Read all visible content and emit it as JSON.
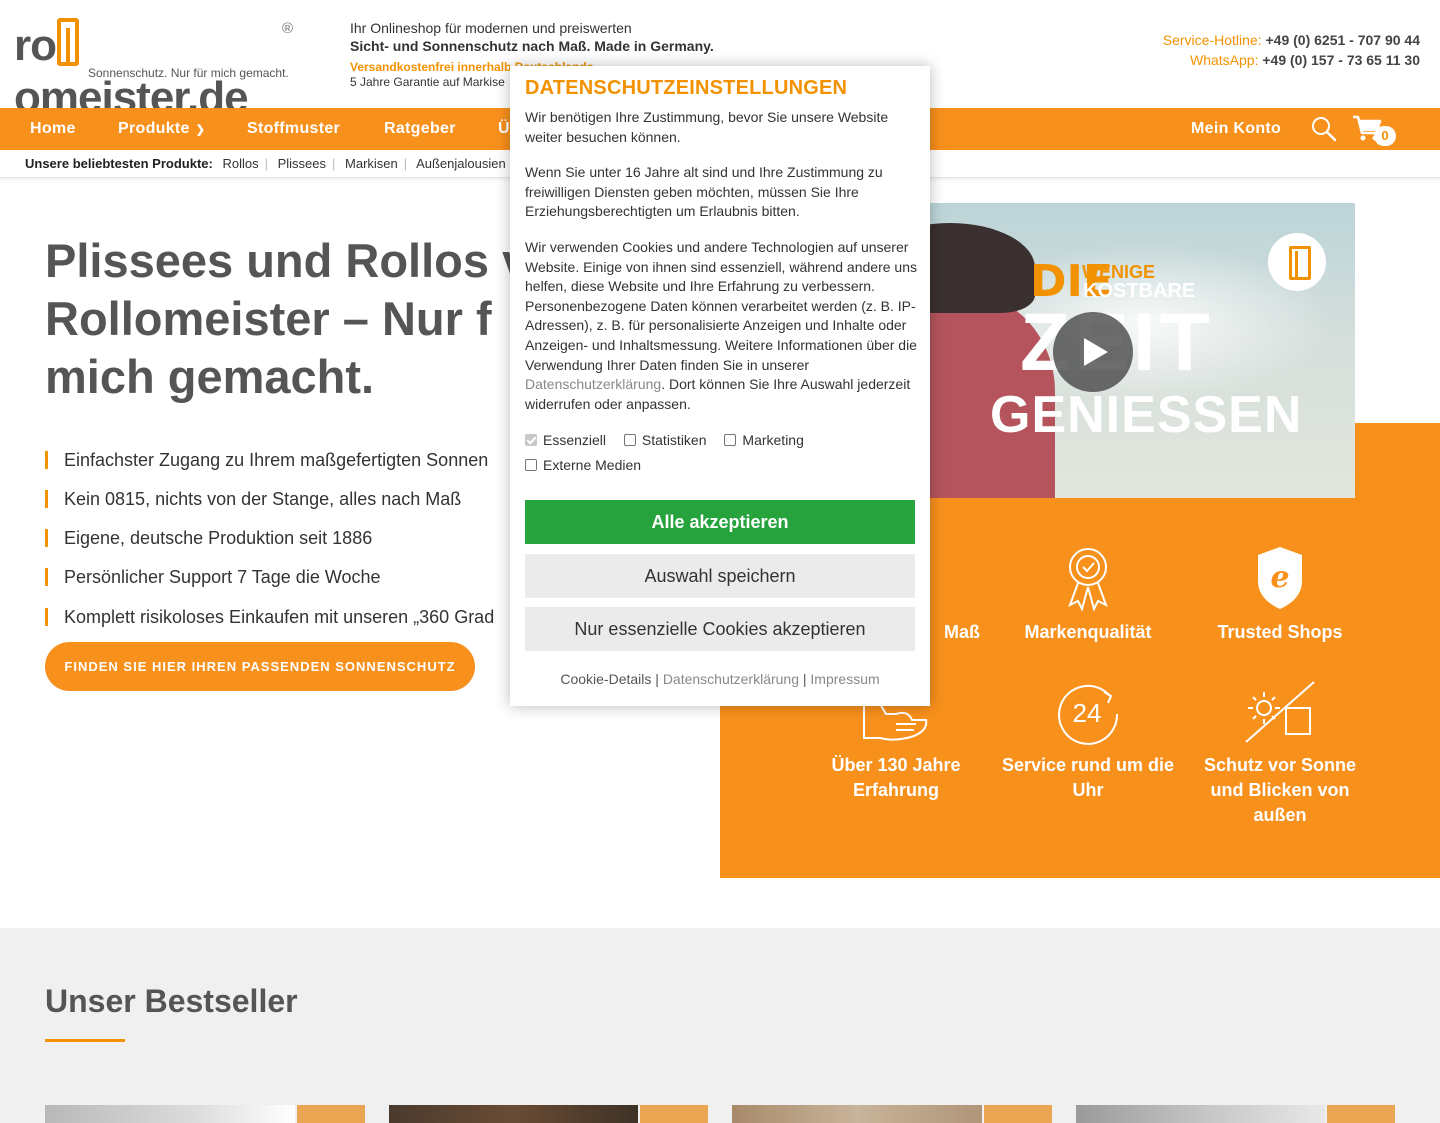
{
  "header": {
    "logo": {
      "text_a": "ro",
      "text_b": "omeister.de",
      "registered": "®",
      "tagline": "Sonnenschutz. Nur für mich gemacht."
    },
    "claim": {
      "line1": "Ihr Onlineshop für modernen und preiswerten",
      "line2": "Sicht- und Sonnenschutz nach Maß. Made in Germany.",
      "line3": "Versandkostenfrei innerhalb Deutschlands",
      "line4_prefix": "5 Jahre Garantie auf",
      "line4_item": "Markise"
    },
    "service_label": "Service-Hotline:",
    "service_number": "+49 (0) 6251 - 707 90 44",
    "whatsapp_label": "WhatsApp:",
    "whatsapp_number": "+49 (0) 157 - 73 65 11 30"
  },
  "nav": {
    "items": [
      {
        "label": "Home"
      },
      {
        "label": "Produkte"
      },
      {
        "label": "Stoffmuster"
      },
      {
        "label": "Ratgeber"
      },
      {
        "label": "Ü"
      }
    ],
    "account": "Mein Konto",
    "cart_count": "0"
  },
  "popular": {
    "label": "Unsere beliebtesten Produkte:",
    "links": [
      "Rollos",
      "Plissees",
      "Markisen",
      "Außenjalousien"
    ]
  },
  "hero": {
    "title_lines": [
      "Plissees und Rollos v",
      "Rollomeister – Nur f",
      "mich gemacht."
    ],
    "benefits": [
      "Einfachster Zugang zu Ihrem maßgefertigten Sonnen",
      "Kein 0815, nichts von der Stange, alles nach Maß",
      "Eigene, deutsche Produktion seit 1886",
      "Persönlicher Support 7 Tage die Woche",
      "Komplett risikoloses Einkaufen mit unseren „360 Grad"
    ],
    "cta": "FINDEN SIE HIER IHREN PASSENDEN SONNENSCHUTZ"
  },
  "video": {
    "t1": "DIE",
    "t2": "WENIGE",
    "t3": "KOSTBARE",
    "t4": "ZEIT",
    "t5": "GENIESSEN"
  },
  "features": [
    {
      "label": "Maß",
      "icon": "ruler-icon"
    },
    {
      "label": "Markenqualität",
      "icon": "award-rosette-icon"
    },
    {
      "label": "Trusted Shops",
      "icon": "trusted-shops-shield-icon"
    },
    {
      "label": "Über 130 Jahre Erfahrung",
      "icon": "handshake-icon"
    },
    {
      "label": "Service rund um die Uhr",
      "icon": "clock-24-icon"
    },
    {
      "label": "Schutz vor Sonne und Blicken von außen",
      "icon": "sun-house-crossed-icon"
    }
  ],
  "bestseller": {
    "title": "Unser Bestseller"
  },
  "modal": {
    "title": "DATENSCHUTZEINSTELLUNGEN",
    "p1": "Wir benötigen Ihre Zustimmung, bevor Sie unsere Website weiter besuchen können.",
    "p2": "Wenn Sie unter 16 Jahre alt sind und Ihre Zustimmung zu freiwilligen Diensten geben möchten, müssen Sie Ihre Erziehungsberechtigten um Erlaubnis bitten.",
    "p3_a": "Wir verwenden Cookies und andere Technologien auf unserer Website. Einige von ihnen sind essenziell, während andere uns helfen, diese Website und Ihre Erfahrung zu verbessern. Personenbezogene Daten können verarbeitet werden (z. B. IP-Adressen), z. B. für personalisierte Anzeigen und Inhalte oder Anzeigen- und Inhaltsmessung. Weitere Informationen über die Verwendung Ihrer Daten finden Sie in unserer ",
    "p3_link": "Datenschutzerklärung",
    "p3_b": ". Dort können Sie Ihre Auswahl jederzeit widerrufen oder anpassen.",
    "checkboxes": [
      {
        "label": "Essenziell",
        "checked": true,
        "disabled": true
      },
      {
        "label": "Statistiken",
        "checked": false
      },
      {
        "label": "Marketing",
        "checked": false
      },
      {
        "label": "Externe Medien",
        "checked": false
      }
    ],
    "btn_accept_all": "Alle akzeptieren",
    "btn_save": "Auswahl speichern",
    "btn_essential": "Nur essenzielle Cookies akzeptieren",
    "link_details": "Cookie-Details",
    "link_privacy": "Datenschutzerklärung",
    "link_imprint": "Impressum",
    "link_sep": "|"
  }
}
